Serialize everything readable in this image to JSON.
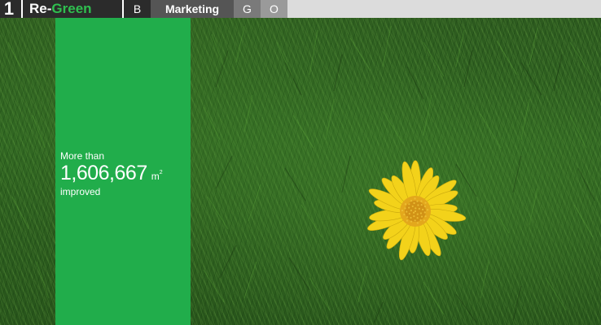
{
  "header": {
    "slide_number": "1",
    "brand_prefix": "Re-",
    "brand_suffix": "Green",
    "nav": [
      {
        "label": "B"
      },
      {
        "label": "Marketing"
      },
      {
        "label": "G"
      },
      {
        "label": "O"
      }
    ]
  },
  "stat": {
    "prefix": "More than",
    "value": "1,606,667",
    "unit": "m",
    "unit_exponent": "2",
    "suffix": "improved"
  },
  "colors": {
    "topbar_bg": "#dcdcdc",
    "brand_bg": "#2b2b2b",
    "brand_accent": "#2fbf4f",
    "panel_green": "#21ad4b",
    "flower_petal": "#f3d21a",
    "flower_center": "#e0a418"
  },
  "icons": {
    "flower": "yellow-daisy-icon"
  }
}
